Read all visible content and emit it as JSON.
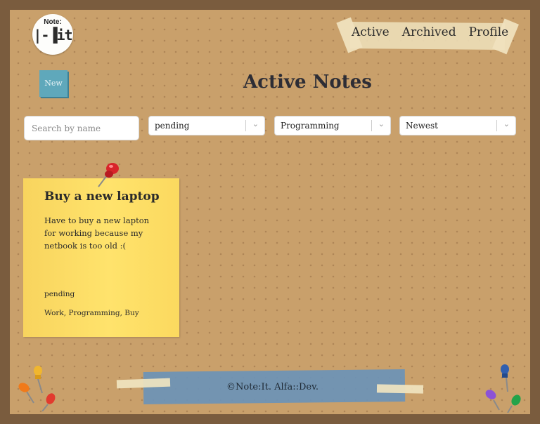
{
  "logo": {
    "top": "Note:",
    "main": "|-▐it"
  },
  "nav": {
    "items": [
      "Active",
      "Archived",
      "Profile"
    ]
  },
  "new_button": {
    "label": "New"
  },
  "page": {
    "title": "Active Notes"
  },
  "filters": {
    "search_placeholder": "Search by name",
    "status": "pending",
    "category": "Programming",
    "sort": "Newest"
  },
  "notes": [
    {
      "title": "Buy a new laptop",
      "body": "Have to buy a new lapton for working because my netbook is too old :(",
      "status": "pending",
      "tags": "Work, Programming, Buy"
    }
  ],
  "footer": {
    "text": "©Note:It. Alfa::Dev."
  },
  "colors": {
    "board": "#c9a06b",
    "frame": "#7a5c3e",
    "note": "#ffe36c",
    "tape_blue": "#6b93b7",
    "new_button": "#5fa8bb"
  }
}
